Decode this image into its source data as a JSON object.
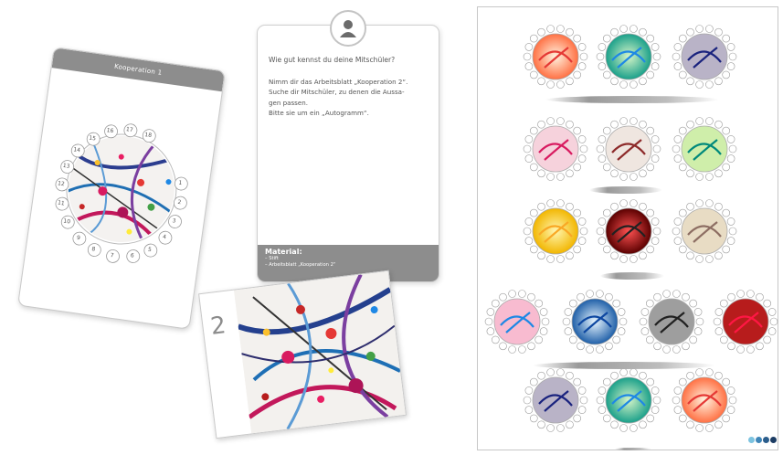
{
  "card_cooperation": {
    "header": "Kooperation 1",
    "numbers": [
      "1",
      "2",
      "3",
      "4",
      "5",
      "6",
      "7",
      "8",
      "9",
      "10",
      "11",
      "12",
      "13",
      "14",
      "15",
      "16",
      "17",
      "18"
    ]
  },
  "card_instructions": {
    "question": "Wie gut kennst du deine Mitschüler?",
    "lines": [
      "Nimm dir das Arbeitsblatt „Kooperation 2“.",
      "Suche dir Mitschüler, zu denen die Aussa-",
      "gen passen.",
      "Bitte sie um ein „Autogramm“."
    ],
    "material_title": "Material:",
    "material_items": [
      "– Stift",
      "– Arbeitsblatt „Kooperation 2“"
    ]
  },
  "card_number": "2",
  "icons": {
    "avatar": "person-icon"
  },
  "colors": {
    "header_gray": "#8d8d8d",
    "logo": [
      "#7cc3e0",
      "#3f86b8",
      "#2a5d8c",
      "#1c3c63"
    ]
  }
}
